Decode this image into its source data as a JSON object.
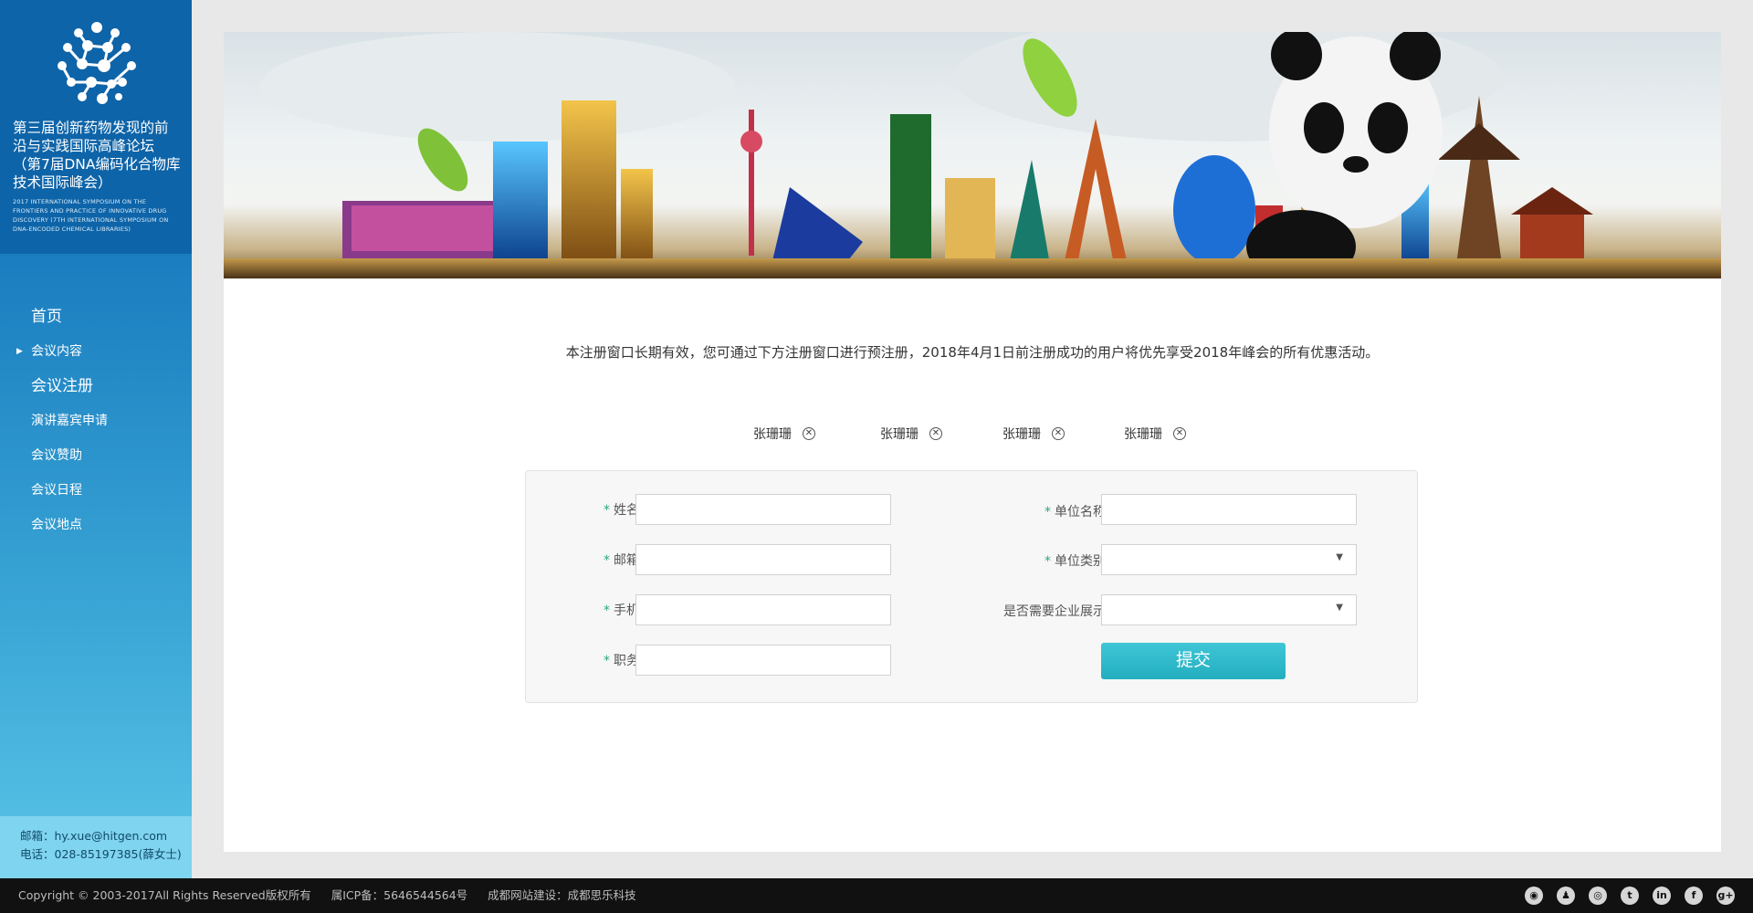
{
  "sidebar": {
    "title": "第三届创新药物发现的前沿与实践国际高峰论坛（第7届DNA编码化合物库技术国际峰会）",
    "subtitle": "2017 INTERNATIONAL SYMPOSIUM ON THE FRONTIERS AND PRACTICE OF INNOVATIVE DRUG DISCOVERY (7TH INTERNATIONAL SYMPOSIUM ON DNA-ENCODED CHEMICAL LIBRARIES)",
    "nav": [
      {
        "label": "首页"
      },
      {
        "label": "会议内容",
        "arrow": "▶"
      },
      {
        "label": "会议注册"
      },
      {
        "label": "演讲嘉宾申请"
      },
      {
        "label": "会议赞助"
      },
      {
        "label": "会议日程"
      },
      {
        "label": "会议地点"
      }
    ],
    "contact": {
      "email": "邮箱：hy.xue@hitgen.com",
      "phone": "电话：028-85197385(薛女士)"
    }
  },
  "main": {
    "notice": "本注册窗口长期有效，您可通过下方注册窗口进行预注册，2018年4月1日前注册成功的用户将优先享受2018年峰会的所有优惠活动。",
    "tags": [
      {
        "name": "张珊珊"
      },
      {
        "name": "张珊珊"
      },
      {
        "name": "张珊珊"
      },
      {
        "name": "张珊珊"
      }
    ],
    "form": {
      "required_mark": "*",
      "name_label": "姓名",
      "email_label": "邮箱",
      "phone_label": "手机",
      "position_label": "职务",
      "org_name_label": "单位名称",
      "org_type_label": "单位类别",
      "display_label": "是否需要企业展示",
      "name_value": "",
      "email_value": "",
      "phone_value": "",
      "position_value": "",
      "org_name_value": "",
      "org_type_value": "",
      "display_value": "",
      "submit_label": "提交"
    }
  },
  "footer": {
    "copyright": "Copyright © 2003-2017All Rights Reserved版权所有",
    "icp": "属ICP备：5646544564号",
    "builder": "成都网站建设：成都思乐科技",
    "socials": [
      "wechat-icon",
      "qq-icon",
      "weibo-icon",
      "twitter-icon",
      "linkedin-icon",
      "facebook-icon",
      "google-plus-icon"
    ]
  },
  "colors": {
    "sidebar_top": "#0e64a8",
    "sidebar_bottom": "#5ac4e6",
    "submit": "#2bb6c6",
    "required": "#2aa67e"
  }
}
